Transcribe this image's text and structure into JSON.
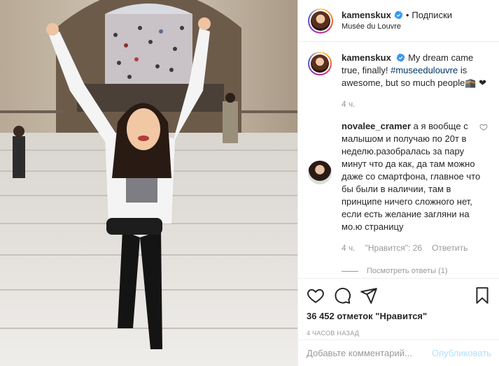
{
  "header": {
    "username": "kamenskux",
    "separator": "•",
    "follow_label": "Подписки",
    "location": "Musée du Louvre"
  },
  "caption": {
    "username": "kamenskux",
    "text_before_tag": "My dream came true, finally! ",
    "hashtag": "#museedulouvre",
    "text_after_tag": " is awesome, but so much people🕋 ❤",
    "time": "4 ч."
  },
  "comment": {
    "username": "novalee_cramer",
    "text": "а я вообще с малышом и получаю по 20т в неделю.разобралась за пару минут что да как, да там можно даже со смартфона, главное что бы были в наличии, там в принципе ничего сложного нет, если есть желание загляни на мо.ю страницу",
    "time": "4 ч.",
    "likes_label": "\"Нравится\": 26",
    "reply_label": "Ответить",
    "view_replies": "Посмотреть ответы (1)"
  },
  "actions": {
    "likes_text": "36 452 отметок \"Нравится\"",
    "timestamp": "4 ЧАСОВ НАЗАД"
  },
  "add_comment": {
    "placeholder": "Добавьте комментарий...",
    "publish_label": "Опубликовать"
  },
  "colors": {
    "verified": "#3897f0",
    "link": "#003569",
    "muted": "#999999",
    "publish_disabled": "#b2dffc"
  },
  "icons": [
    "verified-icon",
    "heart-icon",
    "comment-icon",
    "share-icon",
    "bookmark-icon",
    "small-heart-icon"
  ]
}
